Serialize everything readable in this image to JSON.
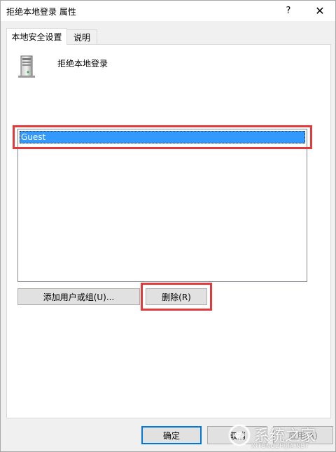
{
  "window": {
    "title": "拒绝本地登录 属性",
    "help_glyph": "?",
    "close_glyph": "✕"
  },
  "tabs": [
    {
      "label": "本地安全设置",
      "active": true
    },
    {
      "label": "说明",
      "active": false
    }
  ],
  "policy": {
    "name": "拒绝本地登录",
    "icon": "server-icon"
  },
  "list": {
    "items": [
      "Guest"
    ],
    "selected_index": 0
  },
  "actions": {
    "add_label": "添加用户或组(U)...",
    "remove_label": "删除(R)"
  },
  "footer": {
    "ok_label": "确定",
    "cancel_label": "取消",
    "apply_label": "应用(A)"
  },
  "watermark": {
    "text": "系统之家",
    "url": "XITONGZHIJIA.NET"
  },
  "colors": {
    "highlight": "#e33b3b",
    "selection": "#3399ff",
    "accent_border": "#0078d7"
  }
}
